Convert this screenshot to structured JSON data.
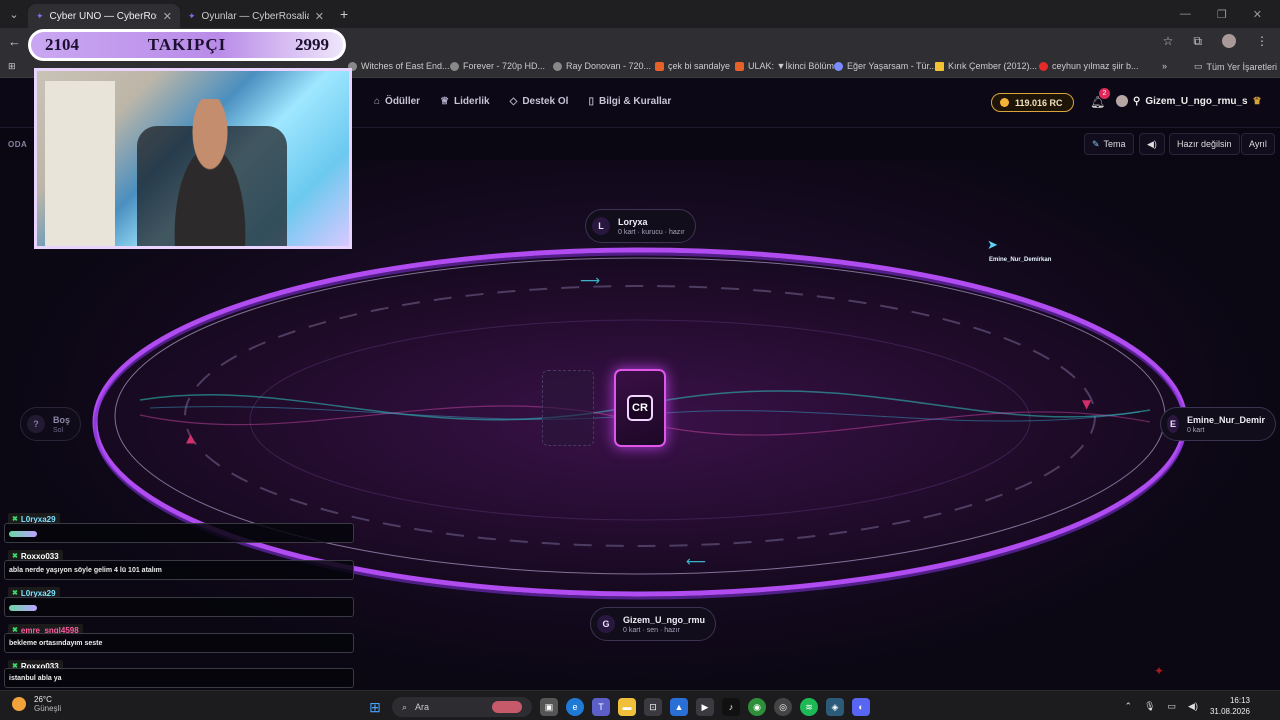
{
  "browser": {
    "tabs": [
      {
        "title": "Cyber UNO — CyberRosalias",
        "active": true
      },
      {
        "title": "Oyunlar — CyberRosalias",
        "active": false
      }
    ],
    "bookmarks": [
      "Witches of East End...",
      "Forever - 720p HD...",
      "Ray Donovan - 720...",
      "çek bi sandalye",
      "ULAK: ▼İkinci Bölüm",
      "Eğer Yaşarsam - Tür...",
      "Kırık Çember (2012)...",
      "ceyhun yılmaz şiir b..."
    ],
    "all_bookmarks": "Tüm Yer İşaretleri"
  },
  "overlay": {
    "followers_current": "2104",
    "followers_label": "TAKIPÇI",
    "followers_goal": "2999"
  },
  "app": {
    "menu": [
      {
        "icon": "gift-icon",
        "label": "Ödüller"
      },
      {
        "icon": "trophy-icon",
        "label": "Liderlik"
      },
      {
        "icon": "diamond-icon",
        "label": "Destek Ol"
      },
      {
        "icon": "book-icon",
        "label": "Bilgi & Kurallar"
      }
    ],
    "balance": "119.016 RC",
    "notifications": "2",
    "username": "Gizem_U_ngo_rmu_s",
    "room_label": "ODA",
    "controls": {
      "theme": "Tema",
      "ready": "Hazır değilsin",
      "leave": "Ayrıl"
    }
  },
  "game": {
    "seats": {
      "top": {
        "initial": "L",
        "name": "Loryxa",
        "status": "0 kart · kurucu · hazır"
      },
      "left": {
        "initial": "?",
        "name": "Boş",
        "status": "Sol"
      },
      "right": {
        "initial": "E",
        "name": "Emine_Nur_Demir",
        "status": "0 kart"
      },
      "bottom": {
        "initial": "G",
        "name": "Gizem_U_ngo_rmu",
        "status": "0 kart · sen · hazır"
      }
    },
    "cursor_user": "Emine_Nur_Demirkan",
    "deck_logo": "CR"
  },
  "chat": [
    {
      "user": "L0ryxa29",
      "color": "#7fe0ff",
      "text": ""
    },
    {
      "user": "Roxxo033",
      "color": "#ffffff",
      "text": "abla nerde yaşıyon söyle gelim 4 lü 101 atalım"
    },
    {
      "user": "L0ryxa29",
      "color": "#7fe0ff",
      "text": ""
    },
    {
      "user": "emre_sngl4598",
      "color": "#ff5aa0",
      "text": "bekleme ortasındayım seste"
    },
    {
      "user": "Roxxo033",
      "color": "#ffffff",
      "text": "istanbul abla ya"
    }
  ],
  "taskbar": {
    "temp": "26°C",
    "weather": "Güneşli",
    "search": "Ara",
    "time": "16:13",
    "date": "31.08.2026"
  }
}
